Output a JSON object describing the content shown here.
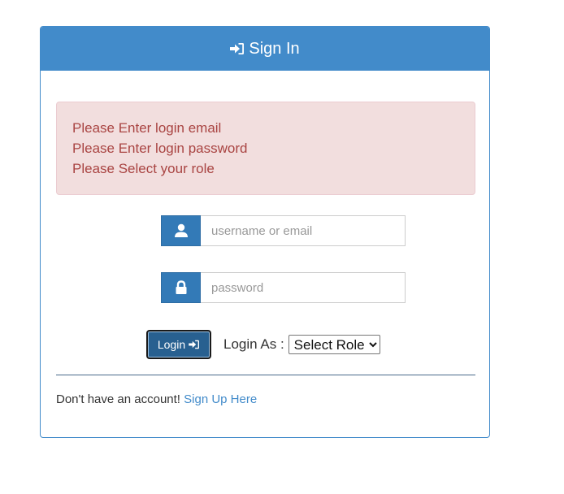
{
  "header": {
    "title": "Sign In",
    "icon": "sign-in-icon"
  },
  "alert": {
    "messages": [
      "Please Enter login email",
      "Please Enter login password",
      "Please Select your role"
    ],
    "color": "#a94442",
    "background": "#f2dede"
  },
  "form": {
    "username": {
      "value": "",
      "placeholder": "username or email",
      "icon": "user-icon"
    },
    "password": {
      "value": "",
      "placeholder": "password",
      "icon": "lock-icon"
    },
    "login_button_label": "Login",
    "login_as_label": "Login As :",
    "role_select": {
      "selected": "Select Role",
      "options": [
        "Select Role"
      ]
    }
  },
  "footer": {
    "prompt_text": "Don't have an account!",
    "signup_link_text": "Sign Up Here"
  },
  "colors": {
    "primary": "#428bca",
    "addon": "#337ab7",
    "button": "#286090"
  }
}
